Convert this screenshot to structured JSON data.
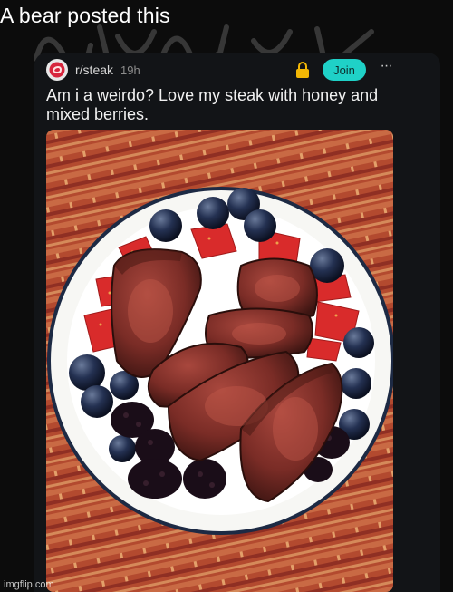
{
  "caption": "A bear posted this",
  "post": {
    "subreddit": "r/steak",
    "time": "19h",
    "join_label": "Join",
    "more_label": "···",
    "title": "Am i a weirdo? Love my steak with honey and mixed berries."
  },
  "watermark": "imgflip.com",
  "colors": {
    "background": "#0c0c0c",
    "card": "#121417",
    "join_button": "#1fd1c7",
    "lock": "#f2b705",
    "avatar_brand": "#d7263d"
  },
  "icons": {
    "subreddit_avatar": "steak-icon",
    "lock": "lock-icon",
    "more": "more-icon"
  }
}
